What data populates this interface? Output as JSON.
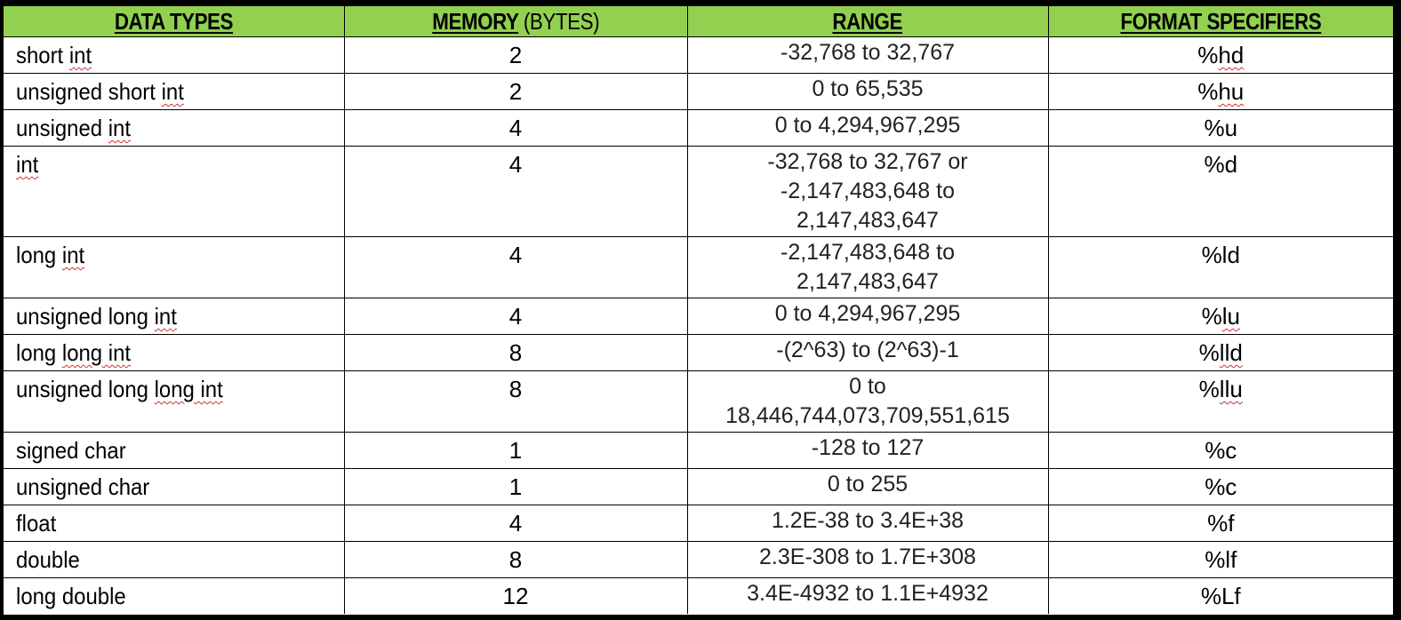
{
  "table": {
    "header_color": "#92d050",
    "headers": {
      "data_types": "DATA TYPES",
      "memory": "MEMORY",
      "memory_unit": "(BYTES)",
      "range": "RANGE",
      "format_specifiers": "FORMAT SPECIFIERS"
    },
    "rows": [
      {
        "type_a": "short ",
        "type_b": "int",
        "memory": "2",
        "range": "-32,768 to 32,767",
        "format": "%hd"
      },
      {
        "type_a": "unsigned short ",
        "type_b": "int",
        "memory": "2",
        "range": "0 to 65,535",
        "format": "%hu"
      },
      {
        "type_a": "unsigned ",
        "type_b": "int",
        "memory": "4",
        "range": "0 to 4,294,967,295",
        "format": "%u"
      },
      {
        "type_a": "",
        "type_b": "int",
        "memory": "4",
        "range": "-32,768 to 32,767 or -2,147,483,648 to 2,147,483,647",
        "format": "%d"
      },
      {
        "type_a": "long ",
        "type_b": "int",
        "memory": "4",
        "range": "-2,147,483,648 to 2,147,483,647",
        "format": "%ld"
      },
      {
        "type_a": "unsigned long ",
        "type_b": "int",
        "memory": "4",
        "range": "0 to 4,294,967,295",
        "format": "%lu"
      },
      {
        "type_a": "long ",
        "type_b": "long int",
        "memory": "8",
        "range": "-(2^63) to (2^63)-1",
        "format": "%lld"
      },
      {
        "type_a": "unsigned long ",
        "type_b": "long int",
        "memory": "8",
        "range_l1": "0 to",
        "range_l2": "18,446,744,073,709,551,615",
        "format": "%llu"
      },
      {
        "type": "signed char",
        "memory": "1",
        "range": "-128 to 127",
        "format": "%c"
      },
      {
        "type": "unsigned char",
        "memory": "1",
        "range": "0 to 255",
        "format": "%c"
      },
      {
        "type": "float",
        "memory": "4",
        "range": "1.2E-38 to 3.4E+38",
        "format": "%f"
      },
      {
        "type": "double",
        "memory": "8",
        "range": "2.3E-308 to 1.7E+308",
        "format": "%lf"
      },
      {
        "type": "long double",
        "memory": "12",
        "range": "3.4E-4932 to 1.1E+4932",
        "format": "%Lf"
      }
    ]
  }
}
